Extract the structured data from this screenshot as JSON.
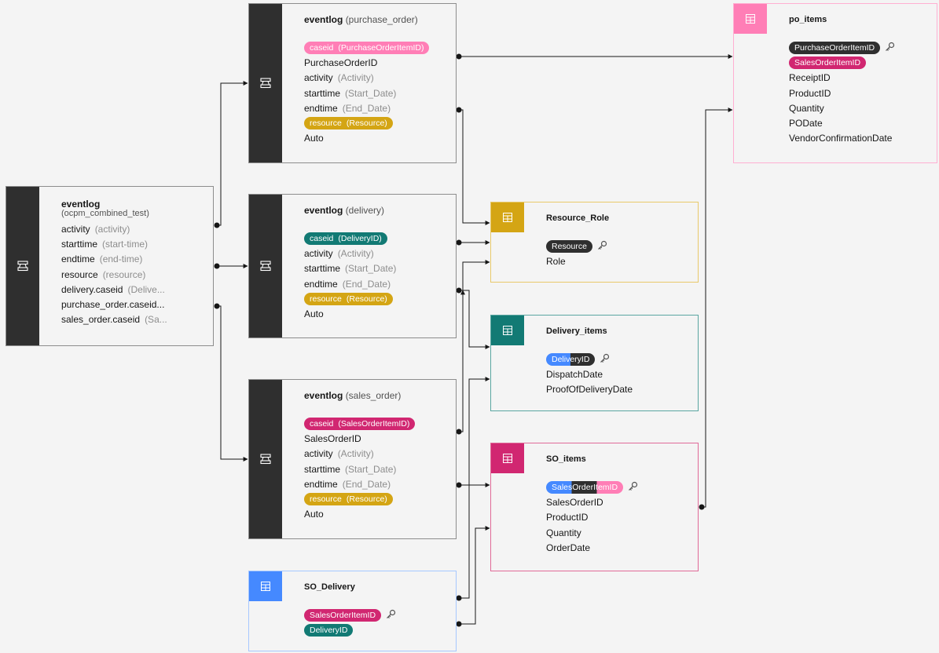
{
  "colors": {
    "dark": "#2f2f2f",
    "yellow": "#d4a514",
    "teal": "#127a74",
    "magenta": "#d12771",
    "pink": "#ff7eb6",
    "blue": "#4589ff",
    "bg": "#f4f4f4"
  },
  "icons": {
    "eventlog": "flow-icon",
    "table": "table-icon",
    "key": "key-icon"
  },
  "eventlog_main": {
    "title": "eventlog",
    "subtitle": "(ocpm_combined_test)",
    "rows": [
      {
        "name": "activity",
        "alias": "(activity)"
      },
      {
        "name": "starttime",
        "alias": "(start-time)"
      },
      {
        "name": "endtime",
        "alias": "(end-time)"
      },
      {
        "name": "resource",
        "alias": "(resource)"
      },
      {
        "name": "delivery.caseid",
        "alias": "(Delive..."
      },
      {
        "name": "purchase_order.caseid...",
        "alias": ""
      },
      {
        "name": "sales_order.caseid",
        "alias": "(Sa..."
      }
    ]
  },
  "eventlog_po": {
    "title": "eventlog",
    "title_sub": "(purchase_order)",
    "caseid": {
      "name": "caseid",
      "alias": "(PurchaseOrderItemID)"
    },
    "f1": "PurchaseOrderID",
    "activity": {
      "name": "activity",
      "alias": "(Activity)"
    },
    "starttime": {
      "name": "starttime",
      "alias": "(Start_Date)"
    },
    "endtime": {
      "name": "endtime",
      "alias": "(End_Date)"
    },
    "resource": {
      "name": "resource",
      "alias": "(Resource)"
    },
    "auto": "Auto"
  },
  "eventlog_del": {
    "title": "eventlog",
    "title_sub": "(delivery)",
    "caseid": {
      "name": "caseid",
      "alias": "(DeliveryID)"
    },
    "activity": {
      "name": "activity",
      "alias": "(Activity)"
    },
    "starttime": {
      "name": "starttime",
      "alias": "(Start_Date)"
    },
    "endtime": {
      "name": "endtime",
      "alias": "(End_Date)"
    },
    "resource": {
      "name": "resource",
      "alias": "(Resource)"
    },
    "auto": "Auto"
  },
  "eventlog_so": {
    "title": "eventlog",
    "title_sub": "(sales_order)",
    "caseid": {
      "name": "caseid",
      "alias": "(SalesOrderItemID)"
    },
    "f1": "SalesOrderID",
    "activity": {
      "name": "activity",
      "alias": "(Activity)"
    },
    "starttime": {
      "name": "starttime",
      "alias": "(Start_Date)"
    },
    "endtime": {
      "name": "endtime",
      "alias": "(End_Date)"
    },
    "resource": {
      "name": "resource",
      "alias": "(Resource)"
    },
    "auto": "Auto"
  },
  "po_items": {
    "title": "po_items",
    "key1": "PurchaseOrderItemID",
    "key2": "SalesOrderItemID",
    "fields": [
      "ReceiptID",
      "ProductID",
      "Quantity",
      "PODate",
      "VendorConfirmationDate"
    ]
  },
  "resource_role": {
    "title": "Resource_Role",
    "key1": "Resource",
    "fields": [
      "Role"
    ]
  },
  "delivery_items": {
    "title": "Delivery_items",
    "key1": "DeliveryID",
    "fields": [
      "DispatchDate",
      "ProofOfDeliveryDate"
    ]
  },
  "so_items": {
    "title": "SO_items",
    "key1": "SalesOrderItemID",
    "fields": [
      "SalesOrderID",
      "ProductID",
      "Quantity",
      "OrderDate"
    ]
  },
  "so_delivery": {
    "title": "SO_Delivery",
    "key1": "SalesOrderItemID",
    "key2": "DeliveryID"
  }
}
